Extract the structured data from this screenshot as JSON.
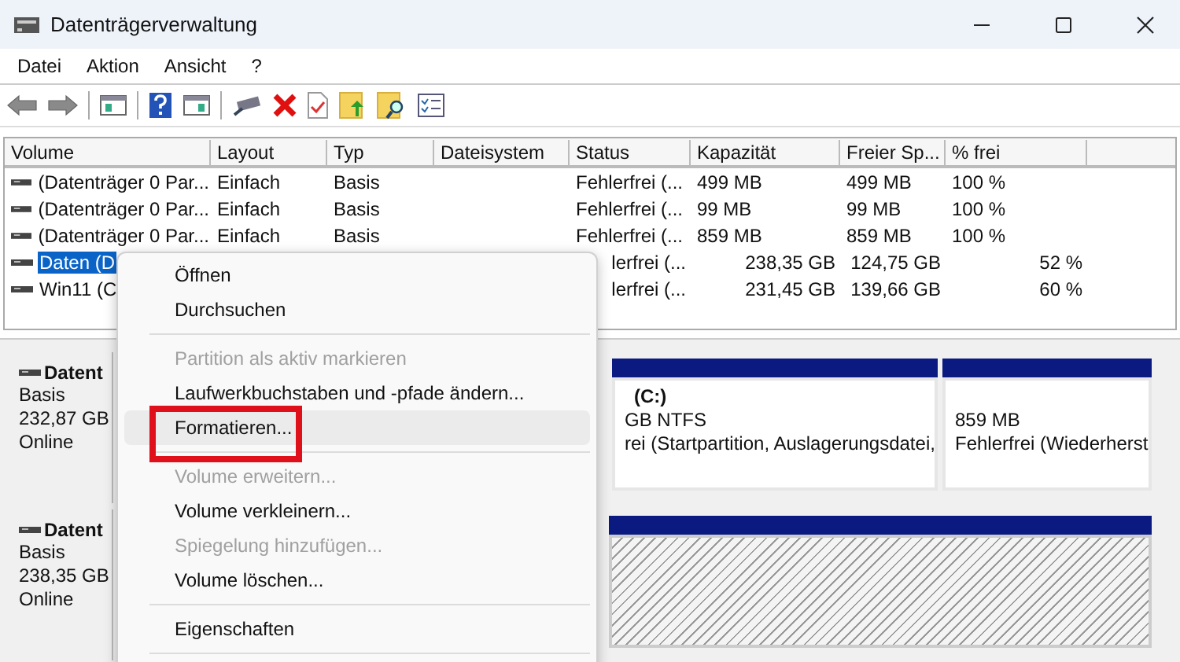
{
  "window": {
    "title": "Datenträgerverwaltung"
  },
  "menu_bar": [
    "Datei",
    "Aktion",
    "Ansicht",
    "?"
  ],
  "table": {
    "columns": [
      "Volume",
      "Layout",
      "Typ",
      "Dateisystem",
      "Status",
      "Kapazität",
      "Freier Sp...",
      "% frei"
    ],
    "rows": [
      {
        "volume": "(Datenträger 0 Par...",
        "layout": "Einfach",
        "typ": "Basis",
        "status": "Fehlerfrei (...",
        "kapazitaet": "499 MB",
        "freier_speicher": "499 MB",
        "prozent_frei": "100 %",
        "selected": false,
        "partly_hidden": false
      },
      {
        "volume": "(Datenträger 0 Par...",
        "layout": "Einfach",
        "typ": "Basis",
        "status": "Fehlerfrei (...",
        "kapazitaet": "99 MB",
        "freier_speicher": "99 MB",
        "prozent_frei": "100 %",
        "selected": false,
        "partly_hidden": false
      },
      {
        "volume": "(Datenträger 0 Par...",
        "layout": "Einfach",
        "typ": "Basis",
        "status": "Fehlerfrei (...",
        "kapazitaet": "859 MB",
        "freier_speicher": "859 MB",
        "prozent_frei": "100 %",
        "selected": false,
        "partly_hidden": false
      },
      {
        "volume": "Daten (D",
        "status": "lerfrei (...",
        "kapazitaet": "238,35 GB",
        "freier_speicher": "124,75 GB",
        "prozent_frei": "52 %",
        "selected": true,
        "partly_hidden": true
      },
      {
        "volume": "Win11 (C",
        "status": "lerfrei (...",
        "kapazitaet": "231,45 GB",
        "freier_speicher": "139,66 GB",
        "prozent_frei": "60 %",
        "selected": false,
        "partly_hidden": true
      }
    ]
  },
  "disks": [
    {
      "name": "Datent",
      "type": "Basis",
      "size": "232,87 GB",
      "state": "Online",
      "partitions": [
        {
          "title": "(C:)",
          "lines": [
            "GB NTFS",
            "rei (Startpartition, Auslagerungsdatei,"
          ],
          "selected": false
        },
        {
          "lines": [
            "859 MB",
            "Fehlerfrei (Wiederherst"
          ],
          "selected": false
        }
      ]
    },
    {
      "name": "Datent",
      "type": "Basis",
      "size": "238,35 GB",
      "state": "Online",
      "partitions": [
        {
          "selected": true
        }
      ]
    }
  ],
  "context_menu": [
    {
      "kind": "item",
      "label": "Öffnen",
      "disabled": false,
      "hovered": false,
      "marked": false
    },
    {
      "kind": "item",
      "label": "Durchsuchen",
      "disabled": false,
      "hovered": false,
      "marked": false
    },
    {
      "kind": "separator"
    },
    {
      "kind": "item",
      "label": "Partition als aktiv markieren",
      "disabled": true,
      "hovered": false,
      "marked": false
    },
    {
      "kind": "item",
      "label": "Laufwerkbuchstaben und -pfade ändern...",
      "disabled": false,
      "hovered": false,
      "marked": false
    },
    {
      "kind": "item",
      "label": "Formatieren...",
      "disabled": false,
      "hovered": true,
      "marked": true
    },
    {
      "kind": "separator"
    },
    {
      "kind": "item",
      "label": "Volume erweitern...",
      "disabled": true,
      "hovered": false,
      "marked": false
    },
    {
      "kind": "item",
      "label": "Volume verkleinern...",
      "disabled": false,
      "hovered": false,
      "marked": false
    },
    {
      "kind": "item",
      "label": "Spiegelung hinzufügen...",
      "disabled": true,
      "hovered": false,
      "marked": false
    },
    {
      "kind": "item",
      "label": "Volume löschen...",
      "disabled": false,
      "hovered": false,
      "marked": false
    },
    {
      "kind": "separator"
    },
    {
      "kind": "item",
      "label": "Eigenschaften",
      "disabled": false,
      "hovered": false,
      "marked": false
    },
    {
      "kind": "separator"
    }
  ]
}
